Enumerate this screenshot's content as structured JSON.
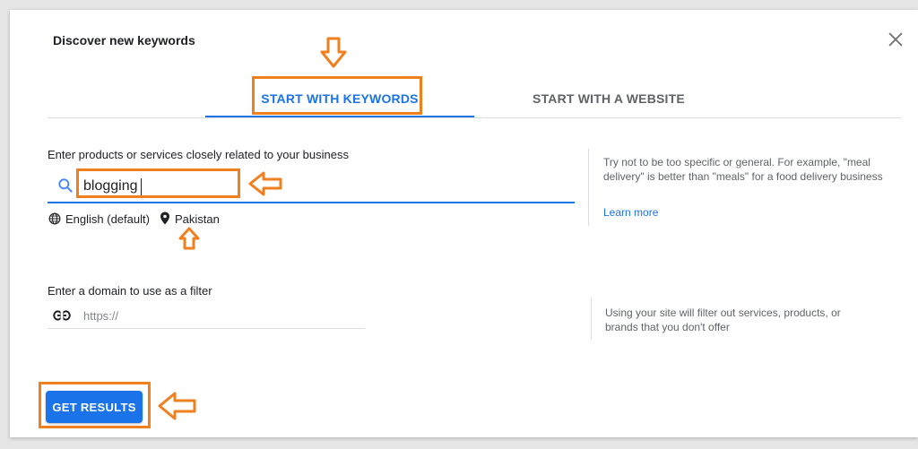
{
  "dialog": {
    "title": "Discover new keywords",
    "close_icon": "close-icon"
  },
  "tabs": [
    {
      "label": "START WITH KEYWORDS",
      "active": true
    },
    {
      "label": "START WITH A WEBSITE",
      "active": false
    }
  ],
  "keywords": {
    "label": "Enter products or services closely related to your business",
    "value": "blogging",
    "language": "English (default)",
    "location": "Pakistan",
    "hint": "Try not to be too specific or general. For example, \"meal delivery\" is better than \"meals\" for a food delivery business",
    "learn_more": "Learn more"
  },
  "domain": {
    "label": "Enter a domain to use as a filter",
    "placeholder": "https://",
    "value": "",
    "hint": "Using your site will filter out services, products, or brands that you don't offer"
  },
  "actions": {
    "get_results": "GET RESULTS"
  },
  "colors": {
    "accent": "#1a73e8",
    "annotation": "#f07f1e",
    "hint_text": "#5f6368"
  }
}
